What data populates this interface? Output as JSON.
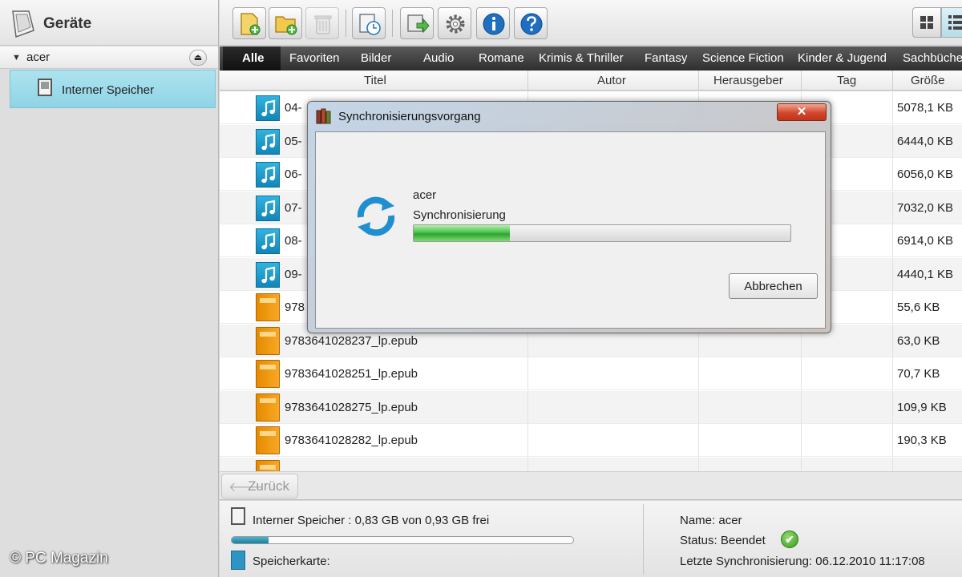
{
  "sidebar": {
    "title": "Geräte",
    "group_label": "acer",
    "group_arrow": "▼",
    "eject_glyph": "⏏",
    "item_label": "Interner Speicher",
    "watermark": "© PC Magazin"
  },
  "toolbar": {
    "buttons": [
      "add-file-icon",
      "add-folder-icon",
      "trash-icon",
      "schedule-icon",
      "sync-icon",
      "gear-icon",
      "info-icon",
      "help-icon"
    ]
  },
  "tabs": [
    "Alle",
    "Favoriten",
    "Bilder",
    "Audio",
    "Romane",
    "Krimis & Thriller",
    "Fantasy",
    "Science Fiction",
    "Kinder & Jugend",
    "Sachbücher"
  ],
  "columns": {
    "title": "Titel",
    "author": "Autor",
    "publisher": "Herausgeber",
    "tag": "Tag",
    "size": "Größe"
  },
  "files": [
    {
      "type": "audio",
      "name": "04-",
      "size": "5078,1 KB"
    },
    {
      "type": "audio",
      "name": "05-",
      "size": "6444,0 KB"
    },
    {
      "type": "audio",
      "name": "06-",
      "size": "6056,0 KB"
    },
    {
      "type": "audio",
      "name": "07-",
      "size": "7032,0 KB"
    },
    {
      "type": "audio",
      "name": "08-",
      "size": "6914,0 KB"
    },
    {
      "type": "audio",
      "name": "09-",
      "size": "4440,1 KB"
    },
    {
      "type": "book",
      "name": "978",
      "size": "55,6 KB"
    },
    {
      "type": "book",
      "name": "9783641028237_lp.epub",
      "size": "63,0 KB"
    },
    {
      "type": "book",
      "name": "9783641028251_lp.epub",
      "size": "70,7 KB"
    },
    {
      "type": "book",
      "name": "9783641028275_lp.epub",
      "size": "109,9 KB"
    },
    {
      "type": "book",
      "name": "9783641028282_lp.epub",
      "size": "190,3 KB"
    },
    {
      "type": "book",
      "name": "",
      "size": ""
    }
  ],
  "back": {
    "arrow": "🡐",
    "label": "Zurück"
  },
  "status": {
    "memory_text": "Interner Speicher : 0,83 GB von 0,93 GB frei",
    "memory_used_fraction": 0.108,
    "card_text": "Speicherkarte:",
    "name": "Name: acer",
    "state": "Status: Beendet",
    "check": "✔",
    "last_sync": "Letzte Synchronisierung: 06.12.2010 11:17:08"
  },
  "dialog": {
    "title": "Synchronisierungsvorgang",
    "close": "✕",
    "device": "acer",
    "action": "Synchronisierung",
    "progress_fraction": 0.255,
    "cancel": "Abbrechen"
  }
}
